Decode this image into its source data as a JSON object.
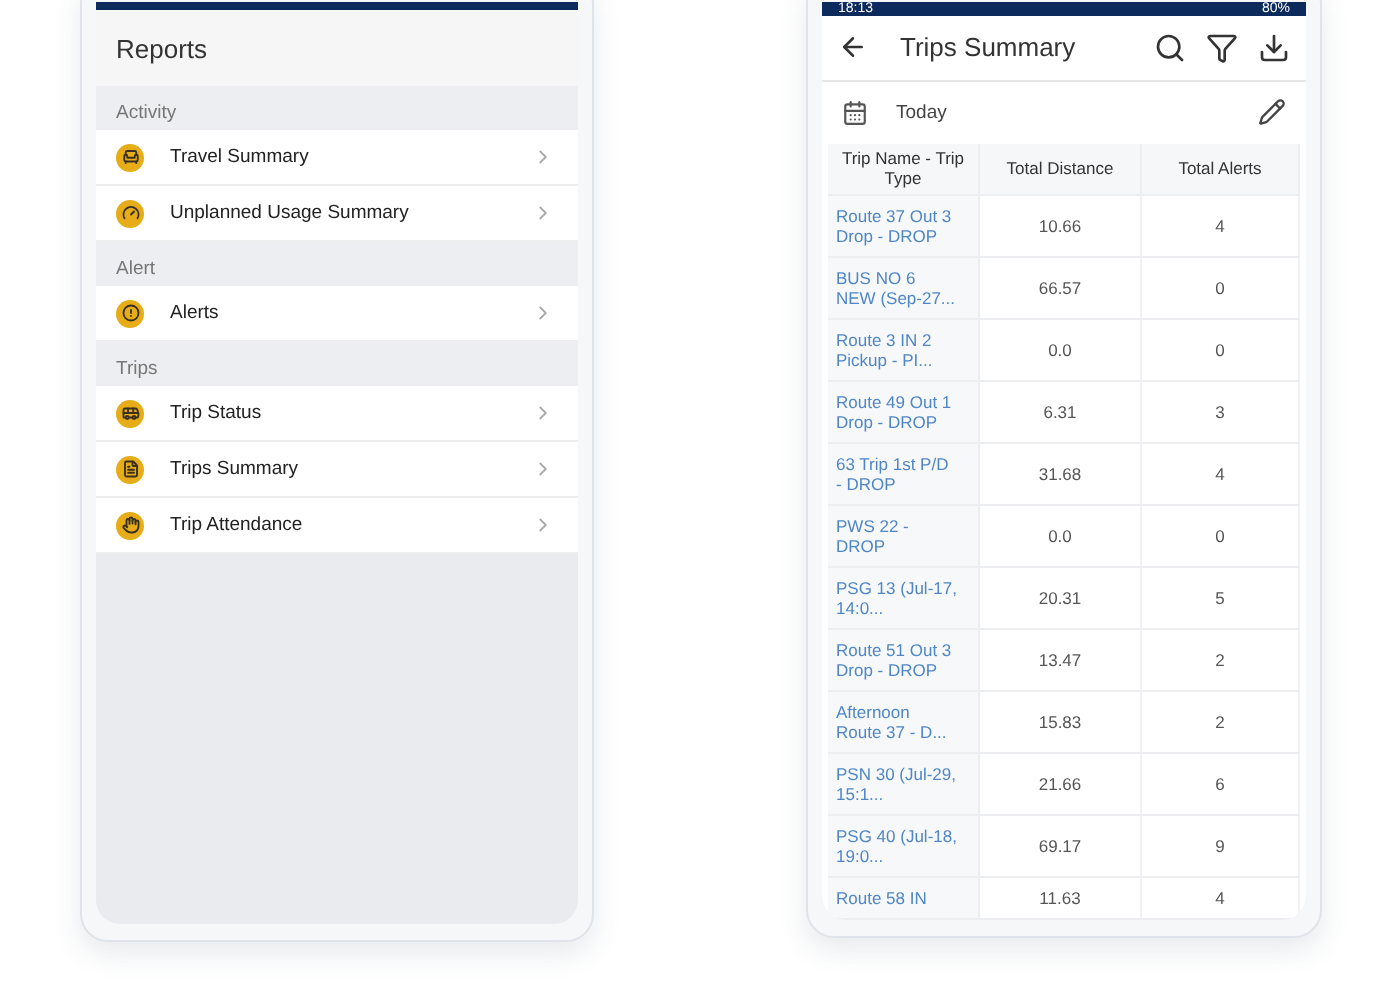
{
  "reports_screen": {
    "title": "Reports",
    "sections": [
      {
        "heading": "Activity",
        "items": [
          {
            "label": "Travel Summary",
            "kind": "seat"
          },
          {
            "label": "Unplanned Usage Summary",
            "kind": "gauge"
          }
        ]
      },
      {
        "heading": "Alert",
        "items": [
          {
            "label": "Alerts",
            "kind": "alert"
          }
        ]
      },
      {
        "heading": "Trips",
        "items": [
          {
            "label": "Trip Status",
            "kind": "bus"
          },
          {
            "label": "Trips Summary",
            "kind": "doc"
          },
          {
            "label": "Trip Attendance",
            "kind": "hand"
          }
        ]
      }
    ]
  },
  "trips_screen": {
    "status_bar": {
      "time": "18:13",
      "battery": "80%"
    },
    "title": "Trips Summary",
    "date_filter": "Today",
    "table": {
      "columns": [
        "Trip Name - Trip Type",
        "Total Distance",
        "Total Alerts"
      ],
      "rows": [
        [
          "Route 37 Out 3 Drop - DROP",
          "10.66",
          "4"
        ],
        [
          "BUS NO 6 NEW (Sep-27...",
          "66.57",
          "0"
        ],
        [
          "Route 3 IN 2 Pickup - PI...",
          "0.0",
          "0"
        ],
        [
          "Route 49 Out 1 Drop - DROP",
          "6.31",
          "3"
        ],
        [
          "63 Trip 1st P/D - DROP",
          "31.68",
          "4"
        ],
        [
          "PWS 22 - DROP",
          "0.0",
          "0"
        ],
        [
          "PSG 13 (Jul-17, 14:0...",
          "20.31",
          "5"
        ],
        [
          "Route 51 Out 3 Drop - DROP",
          "13.47",
          "2"
        ],
        [
          "Afternoon Route 37 - D...",
          "15.83",
          "2"
        ],
        [
          "PSN 30 (Jul-29, 15:1...",
          "21.66",
          "6"
        ],
        [
          "PSG 40 (Jul-18, 19:0...",
          "69.17",
          "9"
        ],
        [
          "Route 58 IN",
          "11.63",
          "4"
        ]
      ]
    }
  }
}
